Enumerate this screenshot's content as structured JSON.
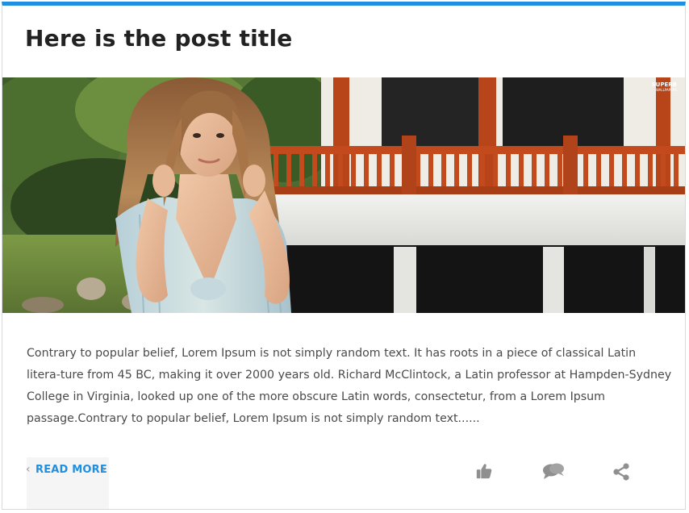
{
  "post": {
    "title": "Here is the post title",
    "image": {
      "watermark_line1": "SUPERB",
      "watermark_line2": "WALLPAPERS"
    },
    "excerpt": "Contrary to popular belief, Lorem Ipsum is not simply random text. It has roots in a piece of classical Latin litera-ture from 45 BC, making it over 2000 years old. Richard McClintock, a Latin professor at Hampden-Sydney College in Virginia, looked up one of the more obscure Latin words, consectetur, from a Lorem Ipsum passage.Contrary to popular belief, Lorem Ipsum is not simply random text......",
    "read_more": {
      "label": "READ MORE",
      "chevron_left": "‹",
      "chevron_right": "›"
    },
    "actions": [
      {
        "icon": "thumbs-up-icon"
      },
      {
        "icon": "comments-icon"
      },
      {
        "icon": "share-icon"
      }
    ]
  },
  "colors": {
    "accent": "#1e8fe1",
    "title": "#222222",
    "text": "#4a4a4a",
    "icon": "#8f8f8f",
    "read_more_bg": "#f5f5f5"
  }
}
